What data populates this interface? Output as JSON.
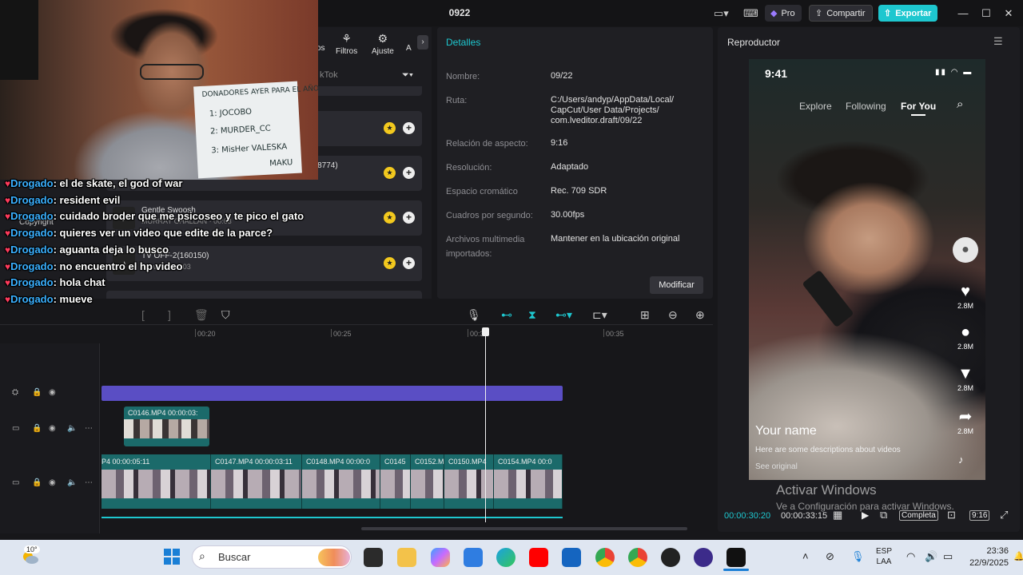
{
  "window": {
    "title": "0922"
  },
  "topbar": {
    "pro_label": "Pro",
    "share_label": "Compartir",
    "export_label": "Exportar"
  },
  "media_panel": {
    "tabs": [
      {
        "label": "os"
      },
      {
        "label": "Filtros",
        "icon": "filters-icon"
      },
      {
        "label": "Ajuste",
        "icon": "adjust-icon"
      },
      {
        "label": "A"
      }
    ],
    "search_placeholder": "kTok",
    "copyright_label": "Copyright",
    "music_items": [
      {
        "title": "",
        "sub": ""
      },
      {
        "title": "sh(1118774)",
        "sub": ""
      },
      {
        "title": "Gentle Swoosh",
        "sub": "MURRAY CHALLAN · 00:03"
      },
      {
        "title": "TV OFF-2(160150)",
        "sub": "TanvY's · 00:03"
      }
    ]
  },
  "details": {
    "title": "Detalles",
    "rows": [
      {
        "label": "Nombre:",
        "value": "09/22"
      },
      {
        "label": "Ruta:",
        "value": "C:/Users/andyp/AppData/Local/ CapCut/User Data/Projects/ com.lveditor.draft/09/22"
      },
      {
        "label": "Relación de aspecto:",
        "value": "9:16"
      },
      {
        "label": "Resolución:",
        "value": "Adaptado"
      },
      {
        "label": "Espacio cromático",
        "value": "Rec. 709 SDR"
      },
      {
        "label": "Cuadros por segundo:",
        "value": "30.00fps"
      },
      {
        "label": "Archivos multimedia importados:",
        "value": "Mantener en la ubicación original"
      }
    ],
    "modify_label": "Modificar"
  },
  "player": {
    "title": "Reproductor",
    "phone": {
      "time": "9:41",
      "tabs": [
        "Explore",
        "Following",
        "For You"
      ],
      "likes": "2.8M",
      "comments": "2.8M",
      "saves": "2.8M",
      "shares": "2.8M",
      "name": "Your name",
      "description": "Here are some descriptions about videos",
      "see_original": "See original"
    },
    "watermark_title": "Activar Windows",
    "watermark_sub": "Ve a Configuración para activar Windows.",
    "time_current": "00:00:30:20",
    "time_total": "00:00:33:15",
    "full_label": "Completa",
    "ratio_label": "9:16"
  },
  "timeline": {
    "ruler": [
      "00:20",
      "00:25",
      "00:30",
      "00:35"
    ],
    "small_clip": {
      "label": "C0146.MP4  00:00:03:"
    },
    "main_clips": [
      {
        "label": "P4  00:00:05:11"
      },
      {
        "label": "C0147.MP4  00:00:03:11"
      },
      {
        "label": "C0148.MP4  00:00:0"
      },
      {
        "label": "C0145"
      },
      {
        "label": "C0152.M"
      },
      {
        "label": "C0150.MP4"
      },
      {
        "label": "C0154.MP4  00:0"
      }
    ]
  },
  "webcam": {
    "board_lines": [
      "DONADORES  AYER PARA EL AÑO",
      "1: JOCOBO",
      "2: MURDER_CC",
      "3: MisHer  VALESKA",
      "MAKU"
    ]
  },
  "chat": [
    {
      "user": "Drogado",
      "message": "el de skate, el god of war"
    },
    {
      "user": "Drogado",
      "message": "resident evil"
    },
    {
      "user": "Drogado",
      "message": "cuidado broder que me psicoseo y te pico el gato"
    },
    {
      "user": "Drogado",
      "message": "quieres ver un video que edite de la parce?"
    },
    {
      "user": "Drogado",
      "message": "aguanta deja lo busco"
    },
    {
      "user": "Drogado",
      "message": "no encuentro el hp video"
    },
    {
      "user": "Drogado",
      "message": "hola chat"
    },
    {
      "user": "Drogado",
      "message": "mueve"
    }
  ],
  "taskbar": {
    "weather_temp": "10°",
    "search_label": "Buscar",
    "lang_line1": "ESP",
    "lang_line2": "LAA",
    "time": "23:36",
    "date": "22/9/2025"
  }
}
